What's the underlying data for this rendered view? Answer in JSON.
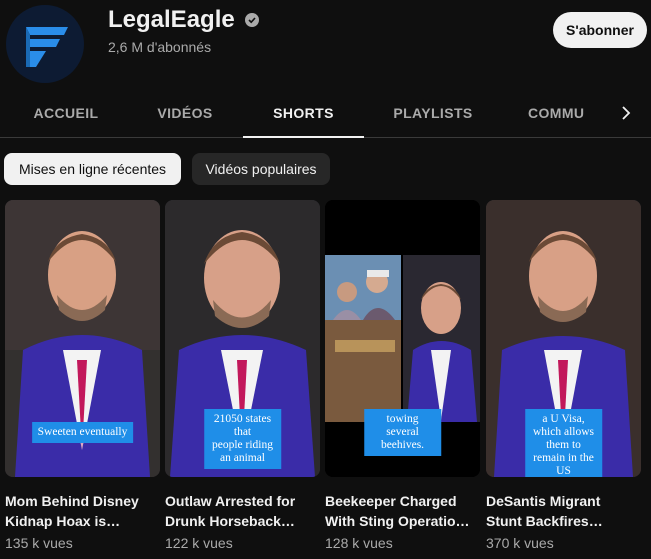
{
  "channel": {
    "name": "LegalEagle",
    "subscribers": "2,6 M d'abonnés",
    "subscribe_label": "S'abonner",
    "brand_color": "#2a8de9"
  },
  "tabs": [
    {
      "label": "ACCUEIL",
      "active": false
    },
    {
      "label": "VIDÉOS",
      "active": false
    },
    {
      "label": "SHORTS",
      "active": true
    },
    {
      "label": "PLAYLISTS",
      "active": false
    },
    {
      "label": "COMMU",
      "active": false
    }
  ],
  "chips": [
    {
      "label": "Mises en ligne récentes",
      "selected": true
    },
    {
      "label": "Vidéos populaires",
      "selected": false
    }
  ],
  "shorts": [
    {
      "title": "Mom Behind Disney\nKidnap Hoax is…",
      "views": "135 k vues",
      "caption": "Sweeten eventually"
    },
    {
      "title": "Outlaw Arrested for\nDrunk Horseback…",
      "views": "122 k vues",
      "caption": "21050 states that\npeople riding an animal"
    },
    {
      "title": "Beekeeper Charged\nWith Sting Operatio…",
      "views": "128 k vues",
      "caption": "towing several\nbeehives."
    },
    {
      "title": "DeSantis Migrant\nStunt Backfires…",
      "views": "370 k vues",
      "caption": "a U Visa, which allows\nthem to remain in the US"
    }
  ],
  "icons": {
    "verified": "check-circle-icon",
    "next": "chevron-right-icon"
  }
}
